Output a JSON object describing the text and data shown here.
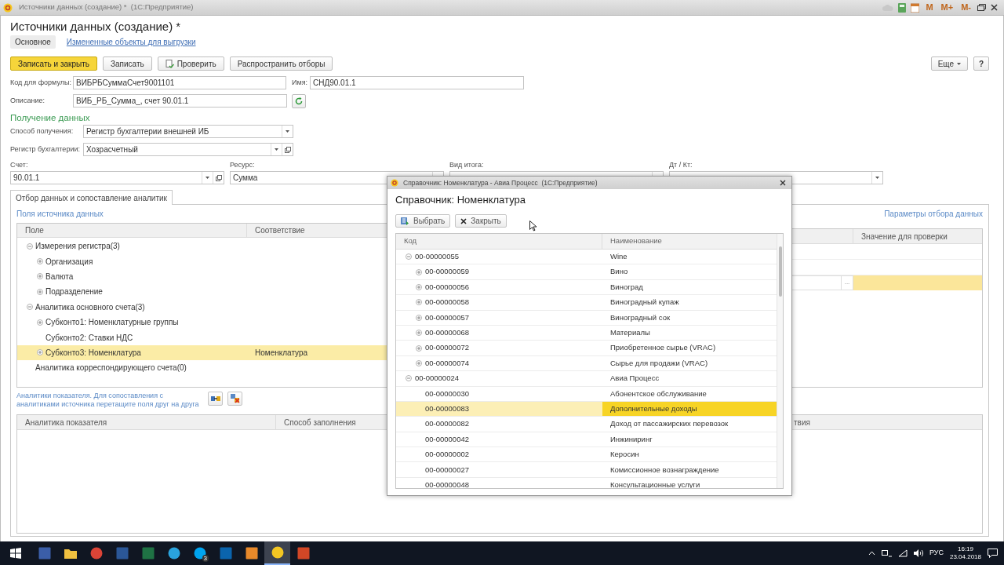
{
  "window": {
    "title": "Источники данных (создание) *  (1С:Предприятие)",
    "memory_buttons": [
      "M",
      "M+",
      "M-"
    ]
  },
  "form": {
    "title": "Источники данных (создание) *",
    "tabs": [
      {
        "label": "Основное",
        "selected": true
      },
      {
        "label": "Измененные объекты для выгрузки",
        "selected": false
      }
    ],
    "toolbar": {
      "buttons": [
        {
          "label": "Записать и закрыть",
          "kind": "primary"
        },
        {
          "label": "Записать",
          "kind": "plain"
        },
        {
          "label": "Проверить",
          "kind": "check"
        },
        {
          "label": "Распространить отборы",
          "kind": "plain"
        }
      ],
      "more": "Еще",
      "help": "?"
    },
    "formula_code": {
      "label": "Код для формулы:",
      "value": "ВИБРБСуммаСчет9001101"
    },
    "name": {
      "label": "Имя:",
      "value": "СНД90.01.1"
    },
    "description": {
      "label": "Описание:",
      "value": "ВИБ_РБ_Сумма_, счет 90.01.1"
    },
    "section_title": "Получение данных",
    "method": {
      "label": "Способ получения:",
      "value": "Регистр бухгалтерии внешней ИБ"
    },
    "register": {
      "label": "Регистр бухгалтерии:",
      "value": "Хозрасчетный"
    },
    "account": {
      "label": "Счет:",
      "value": "90.01.1"
    },
    "resource": {
      "label": "Ресурс:",
      "value": "Сумма"
    },
    "total_type": {
      "label": "Вид итога:"
    },
    "dt_kt": {
      "label": "Дт / Кт:"
    },
    "inner_tab": {
      "label": "Отбор данных и сопоставление аналитик",
      "selected": true
    },
    "source_fields": {
      "link": "Поля источника данных",
      "columns": [
        "Поле",
        "Соответствие"
      ],
      "rows": [
        {
          "label": "Измерения регистра(3)",
          "kind": "group",
          "expanded": true,
          "selected": false,
          "children": [
            {
              "label": "Организация",
              "kind": "group",
              "expanded": false,
              "selected": false
            },
            {
              "label": "Валюта",
              "kind": "group",
              "expanded": false,
              "selected": false
            },
            {
              "label": "Подразделение",
              "kind": "group",
              "expanded": false,
              "selected": false
            }
          ]
        },
        {
          "label": "Аналитика основного счета(3)",
          "kind": "group",
          "expanded": true,
          "selected": false,
          "children": [
            {
              "label": "Субконто1: Номенклатурные группы",
              "kind": "group",
              "expanded": false,
              "selected": false
            },
            {
              "label": "Субконто2: Ставки НДС",
              "kind": "item",
              "selected": false
            },
            {
              "label": "Субконто3: Номенклатура",
              "kind": "group",
              "expanded": false,
              "selected": true,
              "match": "Номенклатура"
            }
          ]
        },
        {
          "label": "Аналитика корреспондирующего счета(0)",
          "kind": "item",
          "selected": false
        }
      ]
    },
    "filter": {
      "link": "Параметры отбора данных",
      "column": "Значение для проверки",
      "choice_button": "..."
    },
    "indicator": {
      "hint": "Аналитики показателя. Для сопоставления с аналитиками источника перетащите поля друг на друга",
      "columns": [
        "Аналитика показателя",
        "Способ заполнения",
        "твия"
      ]
    }
  },
  "dialog": {
    "title": "Справочник: Номенклатура - Авиа Процесс  (1С:Предприятие)",
    "heading": "Справочник: Номенклатура",
    "buttons": [
      {
        "label": "Выбрать",
        "kind": "select"
      },
      {
        "label": "Закрыть",
        "kind": "close"
      }
    ],
    "columns": [
      "Код",
      "Наименование"
    ],
    "rows": [
      {
        "code": "00-00000055",
        "name": "Wine",
        "kind": "group",
        "expanded": true,
        "selected": false,
        "children": [
          {
            "code": "00-00000059",
            "name": "Вино",
            "kind": "group",
            "expanded": false,
            "selected": false
          },
          {
            "code": "00-00000056",
            "name": "Виноград",
            "kind": "group",
            "expanded": false,
            "selected": false
          },
          {
            "code": "00-00000058",
            "name": "Виноградный купаж",
            "kind": "group",
            "expanded": false,
            "selected": false
          },
          {
            "code": "00-00000057",
            "name": "Виноградный сок",
            "kind": "group",
            "expanded": false,
            "selected": false
          },
          {
            "code": "00-00000068",
            "name": "Материалы",
            "kind": "group",
            "expanded": false,
            "selected": false
          },
          {
            "code": "00-00000072",
            "name": "Приобретенное сырье (VRAC)",
            "kind": "group",
            "expanded": false,
            "selected": false
          },
          {
            "code": "00-00000074",
            "name": "Сырье для продажи (VRAC)",
            "kind": "group",
            "expanded": false,
            "selected": false
          }
        ]
      },
      {
        "code": "00-00000024",
        "name": "Авиа Процесс",
        "kind": "group",
        "expanded": true,
        "selected": false,
        "children": [
          {
            "code": "00-00000030",
            "name": "Абонентское обслуживание",
            "kind": "item",
            "selected": false
          },
          {
            "code": "00-00000083",
            "name": "Дополнительные доходы",
            "kind": "item",
            "selected": true
          },
          {
            "code": "00-00000082",
            "name": "Доход от пассажирских перевозок",
            "kind": "item",
            "selected": false
          },
          {
            "code": "00-00000042",
            "name": "Инжиниринг",
            "kind": "item",
            "selected": false
          },
          {
            "code": "00-00000002",
            "name": "Керосин",
            "kind": "item",
            "selected": false
          },
          {
            "code": "00-00000027",
            "name": "Комиссионное вознаграждение",
            "kind": "item",
            "selected": false
          },
          {
            "code": "00-00000048",
            "name": "Консультационные услуги",
            "kind": "item",
            "selected": false
          }
        ]
      }
    ]
  },
  "taskbar": {
    "apps": [
      {
        "kind": "square",
        "color": "#3b5ea8",
        "selected": false
      },
      {
        "kind": "folder",
        "color": "#f0c040",
        "selected": false
      },
      {
        "kind": "circle",
        "color": "#db4437",
        "selected": false
      },
      {
        "kind": "square",
        "color": "#2b5797",
        "selected": false
      },
      {
        "kind": "square",
        "color": "#1f7244",
        "selected": false
      },
      {
        "kind": "circle",
        "color": "#2aa3dd",
        "selected": false
      },
      {
        "kind": "circle",
        "color": "#00a4ef",
        "selected": false,
        "badge": "3"
      },
      {
        "kind": "square",
        "color": "#0a64ad",
        "selected": false
      },
      {
        "kind": "square",
        "color": "#e8892a",
        "selected": false
      },
      {
        "kind": "circle",
        "color": "#f3c623",
        "selected": true
      },
      {
        "kind": "square",
        "color": "#d24726",
        "selected": false
      }
    ],
    "language": "РУС",
    "time": "16:19",
    "date": "23.04.2018"
  }
}
